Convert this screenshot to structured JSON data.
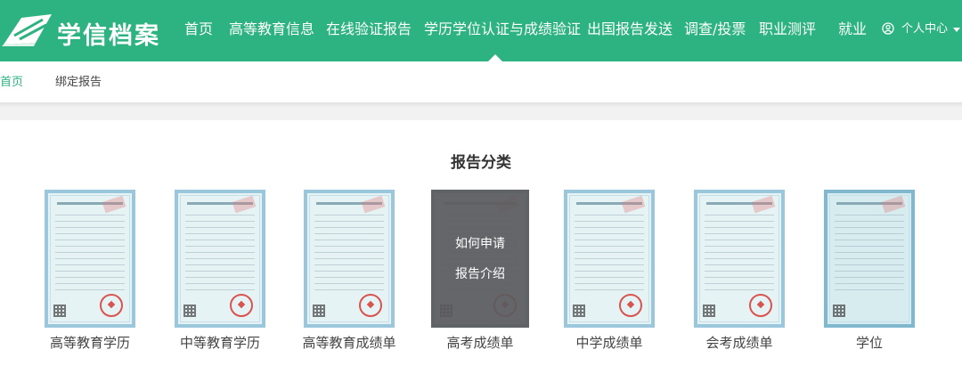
{
  "header": {
    "logo_text": "学信档案",
    "nav": [
      "首页",
      "高等教育信息",
      "在线验证报告",
      "学历学位认证与成绩验证",
      "出国报告发送",
      "调查/投票",
      "职业测评",
      "就业"
    ],
    "active_nav": "学历学位认证与成绩验证",
    "user_label": "个人中心"
  },
  "breadcrumb": {
    "home": "首页",
    "current": "绑定报告"
  },
  "section": {
    "title": "报告分类"
  },
  "cards": [
    {
      "label": "高等教育学历"
    },
    {
      "label": "中等教育学历"
    },
    {
      "label": "高等教育成绩单"
    },
    {
      "label": "高考成绩单",
      "hover_links": [
        "如何申请",
        "报告介绍"
      ]
    },
    {
      "label": "中学成绩单"
    },
    {
      "label": "会考成绩单"
    },
    {
      "label": "学位"
    }
  ],
  "colors": {
    "brand": "#2db381",
    "overlay": "#5a5a5c"
  }
}
